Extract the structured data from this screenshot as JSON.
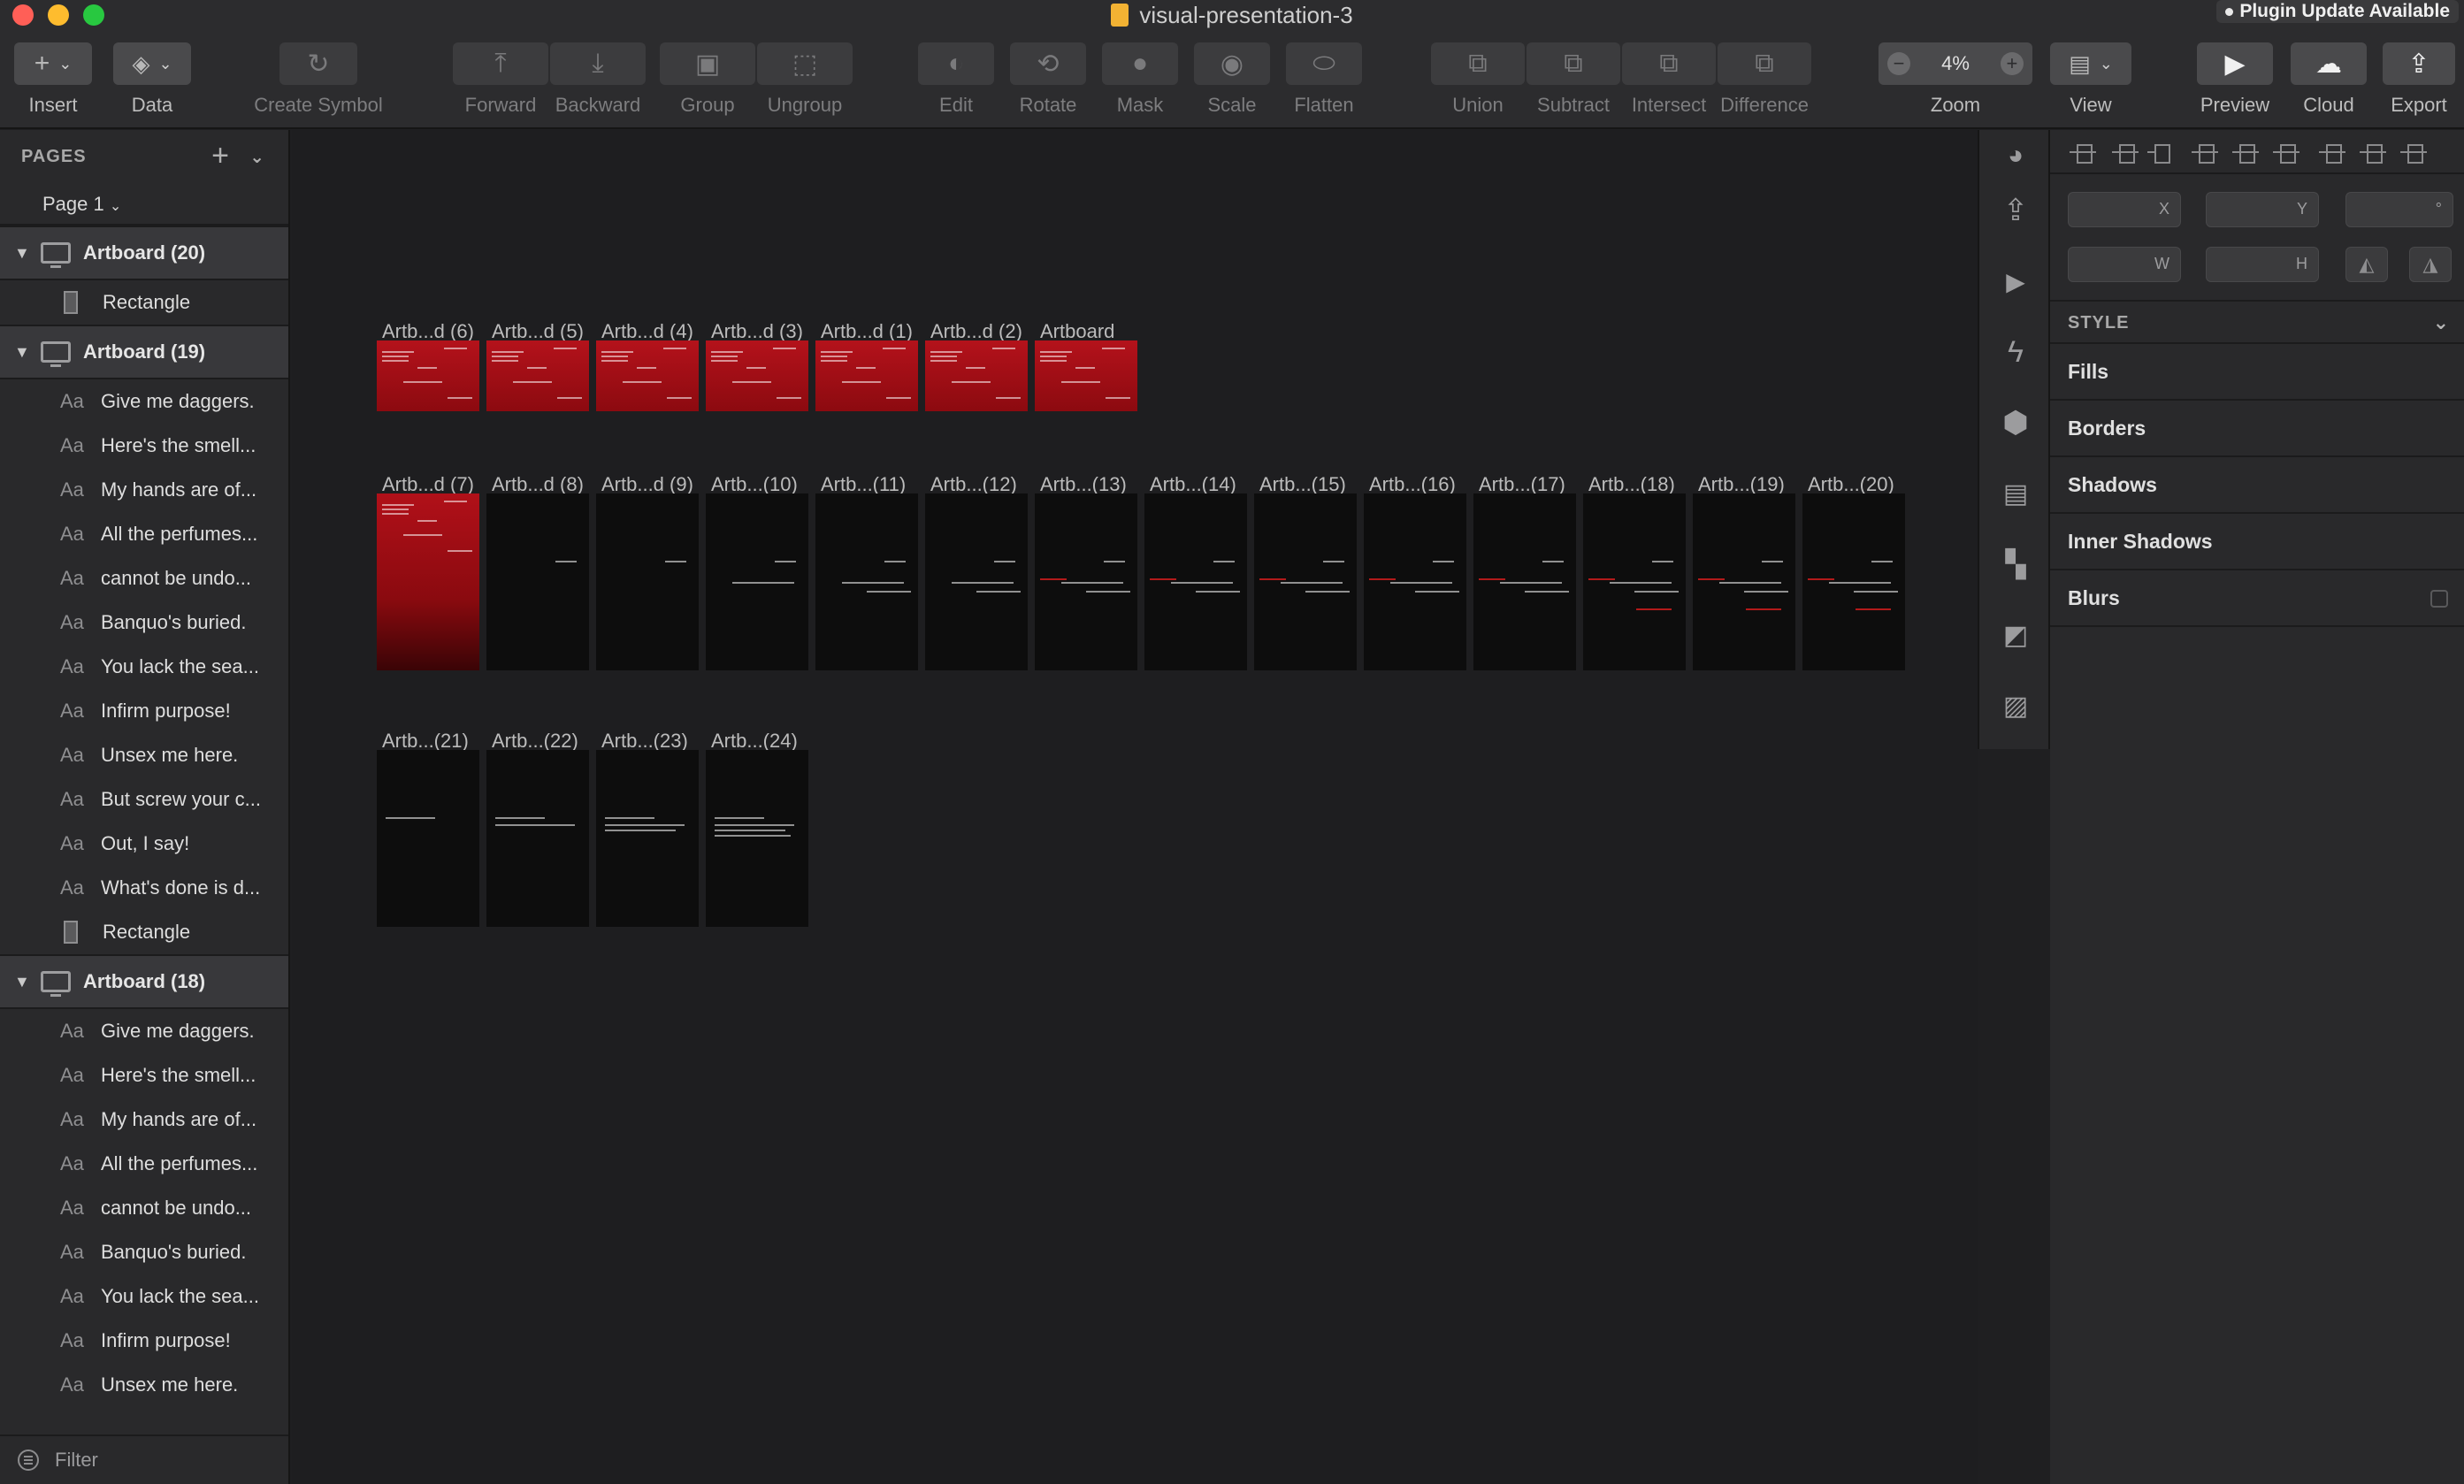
{
  "window": {
    "title": "visual-presentation-3",
    "plugin_update": "Plugin Update Available"
  },
  "toolbar": {
    "insert": "Insert",
    "data": "Data",
    "create_symbol": "Create Symbol",
    "forward": "Forward",
    "backward": "Backward",
    "group": "Group",
    "ungroup": "Ungroup",
    "edit": "Edit",
    "rotate": "Rotate",
    "mask": "Mask",
    "scale": "Scale",
    "flatten": "Flatten",
    "union": "Union",
    "subtract": "Subtract",
    "intersect": "Intersect",
    "difference": "Difference",
    "zoom_label": "Zoom",
    "zoom_value": "4%",
    "view": "View",
    "preview": "Preview",
    "cloud": "Cloud",
    "export": "Export"
  },
  "sidebar": {
    "pages_header": "PAGES",
    "current_page": "Page 1",
    "filter": "Filter",
    "groups": [
      {
        "name": "Artboard (20)",
        "layers": [
          "Rectangle"
        ]
      },
      {
        "name": "Artboard (19)",
        "layers": [
          "Give me daggers.",
          "Here's the smell...",
          "My hands are of...",
          "All the perfumes...",
          "cannot be undo...",
          "Banquo's buried.",
          "You lack the sea...",
          "Infirm purpose!",
          "Unsex me here.",
          "But screw your c...",
          "Out, I say!",
          "What's done is d...",
          "Rectangle"
        ]
      },
      {
        "name": "Artboard (18)",
        "layers": [
          "Give me daggers.",
          "Here's the smell...",
          "My hands are of...",
          "All the perfumes...",
          "cannot be undo...",
          "Banquo's buried.",
          "You lack the sea...",
          "Infirm purpose!",
          "Unsex me here."
        ]
      }
    ]
  },
  "canvas": {
    "rows": [
      [
        "Artb...d (6)",
        "Artb...d (5)",
        "Artb...d (4)",
        "Artb...d (3)",
        "Artb...d (1)",
        "Artb...d (2)",
        "Artboard"
      ],
      [
        "Artb...d (7)",
        "Artb...d (8)",
        "Artb...d (9)",
        "Artb...(10)",
        "Artb...(11)",
        "Artb...(12)",
        "Artb...(13)",
        "Artb...(14)",
        "Artb...(15)",
        "Artb...(16)",
        "Artb...(17)",
        "Artb...(18)",
        "Artb...(19)",
        "Artb...(20)"
      ],
      [
        "Artb...(21)",
        "Artb...(22)",
        "Artb...(23)",
        "Artb...(24)"
      ]
    ]
  },
  "inspector": {
    "x_label": "X",
    "y_label": "Y",
    "rotation_label": "°",
    "w_label": "W",
    "h_label": "H",
    "style_header": "STYLE",
    "fills": "Fills",
    "borders": "Borders",
    "shadows": "Shadows",
    "inner_shadows": "Inner Shadows",
    "blurs": "Blurs"
  },
  "colors": {
    "close": "#ff5f57",
    "minimize": "#febc2e",
    "maximize": "#28c840",
    "artboard_red": "#b4121b",
    "artboard_dark": "#0d0d0d"
  }
}
